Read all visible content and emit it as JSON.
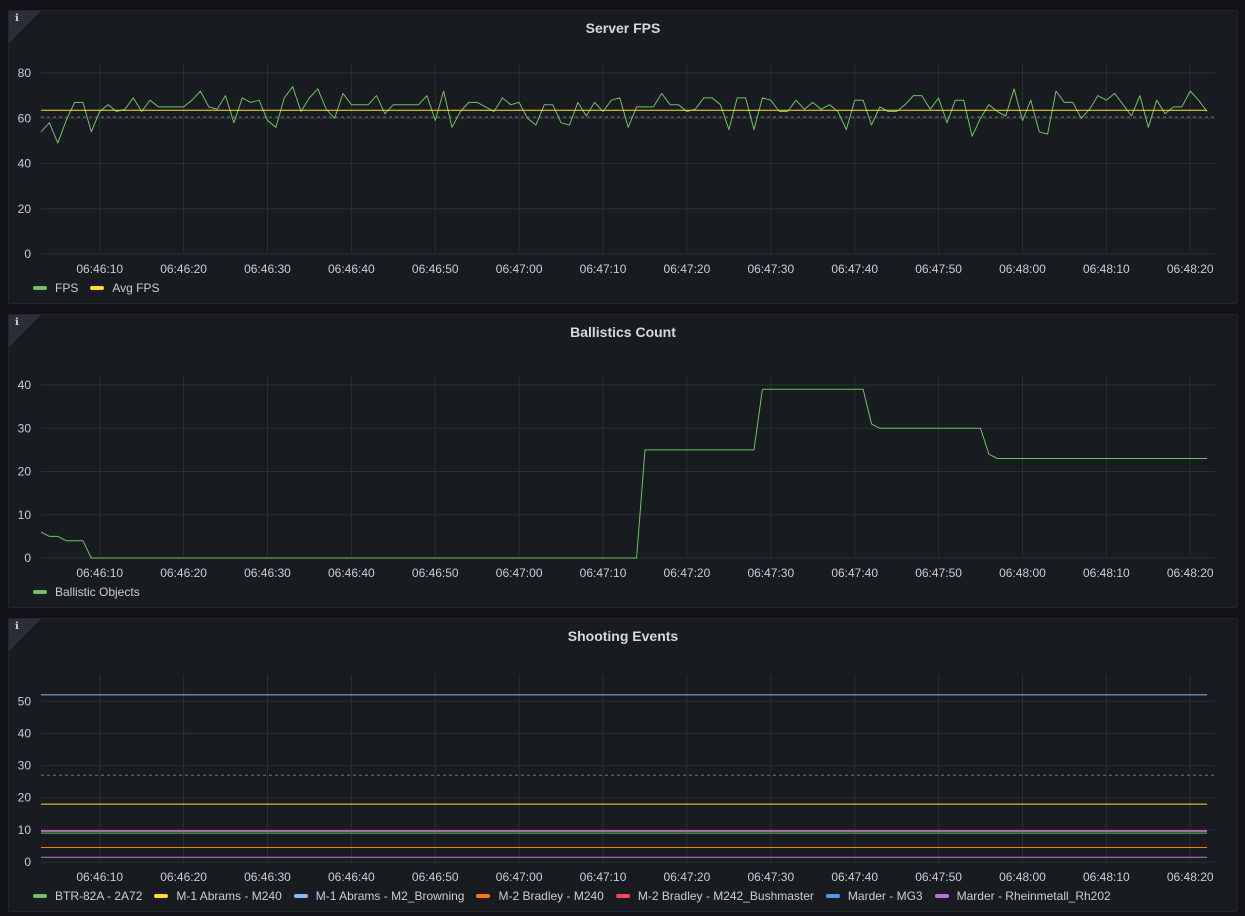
{
  "panels": [
    {
      "title": "Server FPS",
      "info_icon": "info-icon",
      "legend": [
        {
          "label": "FPS",
          "color": "#73bf69"
        },
        {
          "label": "Avg FPS",
          "color": "#fade2a"
        }
      ]
    },
    {
      "title": "Ballistics Count",
      "info_icon": "info-icon",
      "legend": [
        {
          "label": "Ballistic Objects",
          "color": "#73bf69"
        }
      ]
    },
    {
      "title": "Shooting Events",
      "info_icon": "info-icon",
      "legend": [
        {
          "label": "BTR-82A - 2A72",
          "color": "#73bf69"
        },
        {
          "label": "M-1 Abrams - M240",
          "color": "#fade2a"
        },
        {
          "label": "M-1 Abrams - M2_Browning",
          "color": "#8ab8ff"
        },
        {
          "label": "M-2 Bradley - M240",
          "color": "#ff780a"
        },
        {
          "label": "M-2 Bradley - M242_Bushmaster",
          "color": "#f2495c"
        },
        {
          "label": "Marder - MG3",
          "color": "#5794f2"
        },
        {
          "label": "Marder - Rheinmetall_Rh202",
          "color": "#b877d9"
        }
      ]
    }
  ],
  "chart_data": [
    {
      "type": "line",
      "title": "Server FPS",
      "x_ticks": [
        "06:46:10",
        "06:46:20",
        "06:46:30",
        "06:46:40",
        "06:46:50",
        "06:47:00",
        "06:47:10",
        "06:47:20",
        "06:47:30",
        "06:47:40",
        "06:47:50",
        "06:48:00",
        "06:48:10",
        "06:48:20"
      ],
      "x_range_seconds": [
        -7,
        132
      ],
      "y_ticks": [
        "0",
        "20",
        "40",
        "60",
        "80"
      ],
      "ylim": [
        0,
        80
      ],
      "threshold_line": 60.5,
      "grid": true,
      "series": [
        {
          "name": "FPS",
          "color": "#73bf69",
          "x": [
            -7,
            -6,
            -5,
            -4,
            -3,
            -2,
            -1,
            0,
            1,
            2,
            3,
            4,
            5,
            6,
            7,
            8,
            9,
            10,
            11,
            12,
            13,
            14,
            15,
            16,
            17,
            18,
            19,
            20,
            21,
            22,
            23,
            24,
            25,
            26,
            27,
            28,
            29,
            30,
            31,
            32,
            33,
            34,
            35,
            36,
            37,
            38,
            39,
            40,
            41,
            42,
            43,
            44,
            45,
            46,
            47,
            48,
            49,
            50,
            51,
            52,
            53,
            54,
            55,
            56,
            57,
            58,
            59,
            60,
            61,
            62,
            63,
            64,
            65,
            66,
            67,
            68,
            69,
            70,
            71,
            72,
            73,
            74,
            75,
            76,
            77,
            78,
            79,
            80,
            81,
            82,
            83,
            84,
            85,
            86,
            87,
            88,
            89,
            90,
            91,
            92,
            93,
            94,
            95,
            96,
            97,
            98,
            99,
            100,
            101,
            102,
            103,
            104,
            105,
            106,
            107,
            108,
            109,
            110,
            111,
            112,
            113,
            114,
            115,
            116,
            117,
            118,
            119,
            120,
            121,
            122,
            123,
            124,
            125,
            126,
            127,
            128,
            129,
            130,
            131,
            132
          ],
          "values": [
            54,
            58,
            49,
            59,
            67,
            67,
            54,
            63,
            66,
            63,
            64,
            69,
            63,
            68,
            65,
            65,
            65,
            65,
            68,
            72,
            65,
            64,
            70,
            58,
            69,
            67,
            68,
            59,
            56,
            69,
            74,
            63,
            69,
            73,
            64,
            60,
            71,
            66,
            66,
            66,
            70,
            62,
            66,
            66,
            66,
            66,
            70,
            59,
            72,
            56,
            63,
            67,
            67,
            65,
            63,
            69,
            66,
            67,
            60,
            57,
            66,
            66,
            58,
            57,
            67,
            61,
            67,
            63,
            68,
            69,
            56,
            65,
            65,
            65,
            71,
            66,
            66,
            63,
            64,
            69,
            69,
            66,
            55,
            69,
            69,
            55,
            69,
            68,
            63,
            63,
            68,
            64,
            67,
            64,
            66,
            63,
            55,
            68,
            68,
            57,
            65,
            63,
            63,
            66,
            70,
            70,
            64,
            69,
            58,
            68,
            68,
            52,
            60,
            66,
            63,
            61,
            73,
            59,
            68,
            54,
            53,
            72,
            67,
            67,
            60,
            64,
            70,
            68,
            71,
            66,
            61,
            70,
            56,
            68,
            62,
            65,
            65,
            72,
            68,
            63
          ]
        },
        {
          "name": "Avg FPS",
          "color": "#fade2a",
          "x": [
            -7,
            132
          ],
          "values": [
            63.5,
            63.5
          ]
        }
      ]
    },
    {
      "type": "line",
      "title": "Ballistics Count",
      "x_ticks": [
        "06:46:10",
        "06:46:20",
        "06:46:30",
        "06:46:40",
        "06:46:50",
        "06:47:00",
        "06:47:10",
        "06:47:20",
        "06:47:30",
        "06:47:40",
        "06:47:50",
        "06:48:00",
        "06:48:10",
        "06:48:20"
      ],
      "x_range_seconds": [
        -7,
        132
      ],
      "y_ticks": [
        "0",
        "10",
        "20",
        "30",
        "40"
      ],
      "ylim": [
        0,
        40
      ],
      "grid": true,
      "series": [
        {
          "name": "Ballistic Objects",
          "color": "#73bf69",
          "x": [
            -7,
            -6,
            -5,
            -4,
            -3,
            -2,
            -1,
            0,
            64,
            65,
            78,
            79,
            91,
            92,
            93,
            105,
            106,
            107,
            132
          ],
          "values": [
            6,
            5,
            5,
            4,
            4,
            4,
            0,
            0,
            0,
            25,
            25,
            39,
            39,
            31,
            30,
            30,
            24,
            23,
            23
          ]
        }
      ]
    },
    {
      "type": "line",
      "title": "Shooting Events",
      "x_ticks": [
        "06:46:10",
        "06:46:20",
        "06:46:30",
        "06:46:40",
        "06:46:50",
        "06:47:00",
        "06:47:10",
        "06:47:20",
        "06:47:30",
        "06:47:40",
        "06:47:50",
        "06:48:00",
        "06:48:10",
        "06:48:20"
      ],
      "x_range_seconds": [
        -7,
        132
      ],
      "y_ticks": [
        "0",
        "10",
        "20",
        "30",
        "40",
        "50"
      ],
      "ylim": [
        0,
        56
      ],
      "threshold_line": 27,
      "grid": true,
      "series": [
        {
          "name": "BTR-82A - 2A72",
          "color": "#73bf69",
          "x": [
            -7,
            132
          ],
          "values": [
            9,
            9
          ]
        },
        {
          "name": "M-1 Abrams - M240",
          "color": "#fade2a",
          "x": [
            -7,
            132
          ],
          "values": [
            18,
            18
          ]
        },
        {
          "name": "M-1 Abrams - M2_Browning",
          "color": "#8ab8ff",
          "x": [
            -7,
            132
          ],
          "values": [
            52,
            52
          ]
        },
        {
          "name": "M-2 Bradley - M240",
          "color": "#ff780a",
          "x": [
            -7,
            132
          ],
          "values": [
            4.5,
            4.5
          ]
        },
        {
          "name": "M-2 Bradley - M242_Bushmaster",
          "color": "#f2495c",
          "x": [
            -7,
            132
          ],
          "values": [
            9.5,
            9.5
          ]
        },
        {
          "name": "Marder - MG3",
          "color": "#5794f2",
          "x": [
            -7,
            132
          ],
          "values": [
            9.8,
            9.8
          ]
        },
        {
          "name": "Marder - Rheinmetall_Rh202",
          "color": "#b877d9",
          "x": [
            -7,
            132
          ],
          "values": [
            1.5,
            1.5
          ]
        }
      ]
    }
  ]
}
